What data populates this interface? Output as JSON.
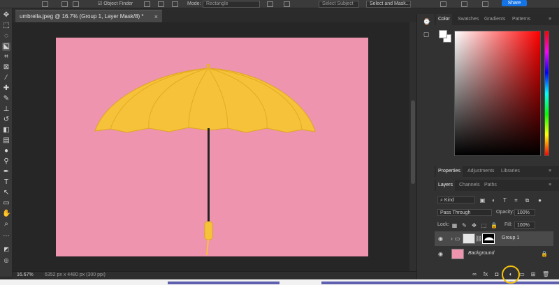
{
  "options_bar": {
    "object_finder": "Object Finder",
    "mode_label": "Mode:",
    "mode_value": "Rectangle",
    "select_subject": "Select Subject",
    "select_mask": "Select and Mask...",
    "share": "Share"
  },
  "document": {
    "tab_title": "umbrella.jpeg @ 16.7% (Group 1, Layer Mask/8) *",
    "close": "×",
    "canvas_color": "#ee94ae"
  },
  "status": {
    "zoom": "16.67%",
    "info": "6352 px x 4480 px (300 ppi)"
  },
  "color_panel": {
    "tabs": [
      "Color",
      "Swatches",
      "Gradients",
      "Patterns"
    ],
    "active_tab": "Color",
    "foreground": "#ffffff",
    "background": "#ffffff"
  },
  "properties_panel": {
    "tabs": [
      "Properties",
      "Adjustments",
      "Libraries"
    ],
    "active_tab": "Properties"
  },
  "layers_panel": {
    "tabs": [
      "Layers",
      "Channels",
      "Paths"
    ],
    "active_tab": "Layers",
    "filter_kind": "Kind",
    "blend_mode": "Pass Through",
    "opacity_label": "Opacity:",
    "opacity_value": "100%",
    "lock_label": "Lock:",
    "fill_label": "Fill:",
    "fill_value": "100%",
    "layers": [
      {
        "name": "Group 1",
        "selected": true,
        "type": "group"
      },
      {
        "name": "Background",
        "selected": false,
        "type": "image"
      }
    ]
  },
  "colors": {
    "umbrella": "#f5c23a",
    "highlight_ring": "#f4c20d",
    "share_button": "#1473e6"
  }
}
